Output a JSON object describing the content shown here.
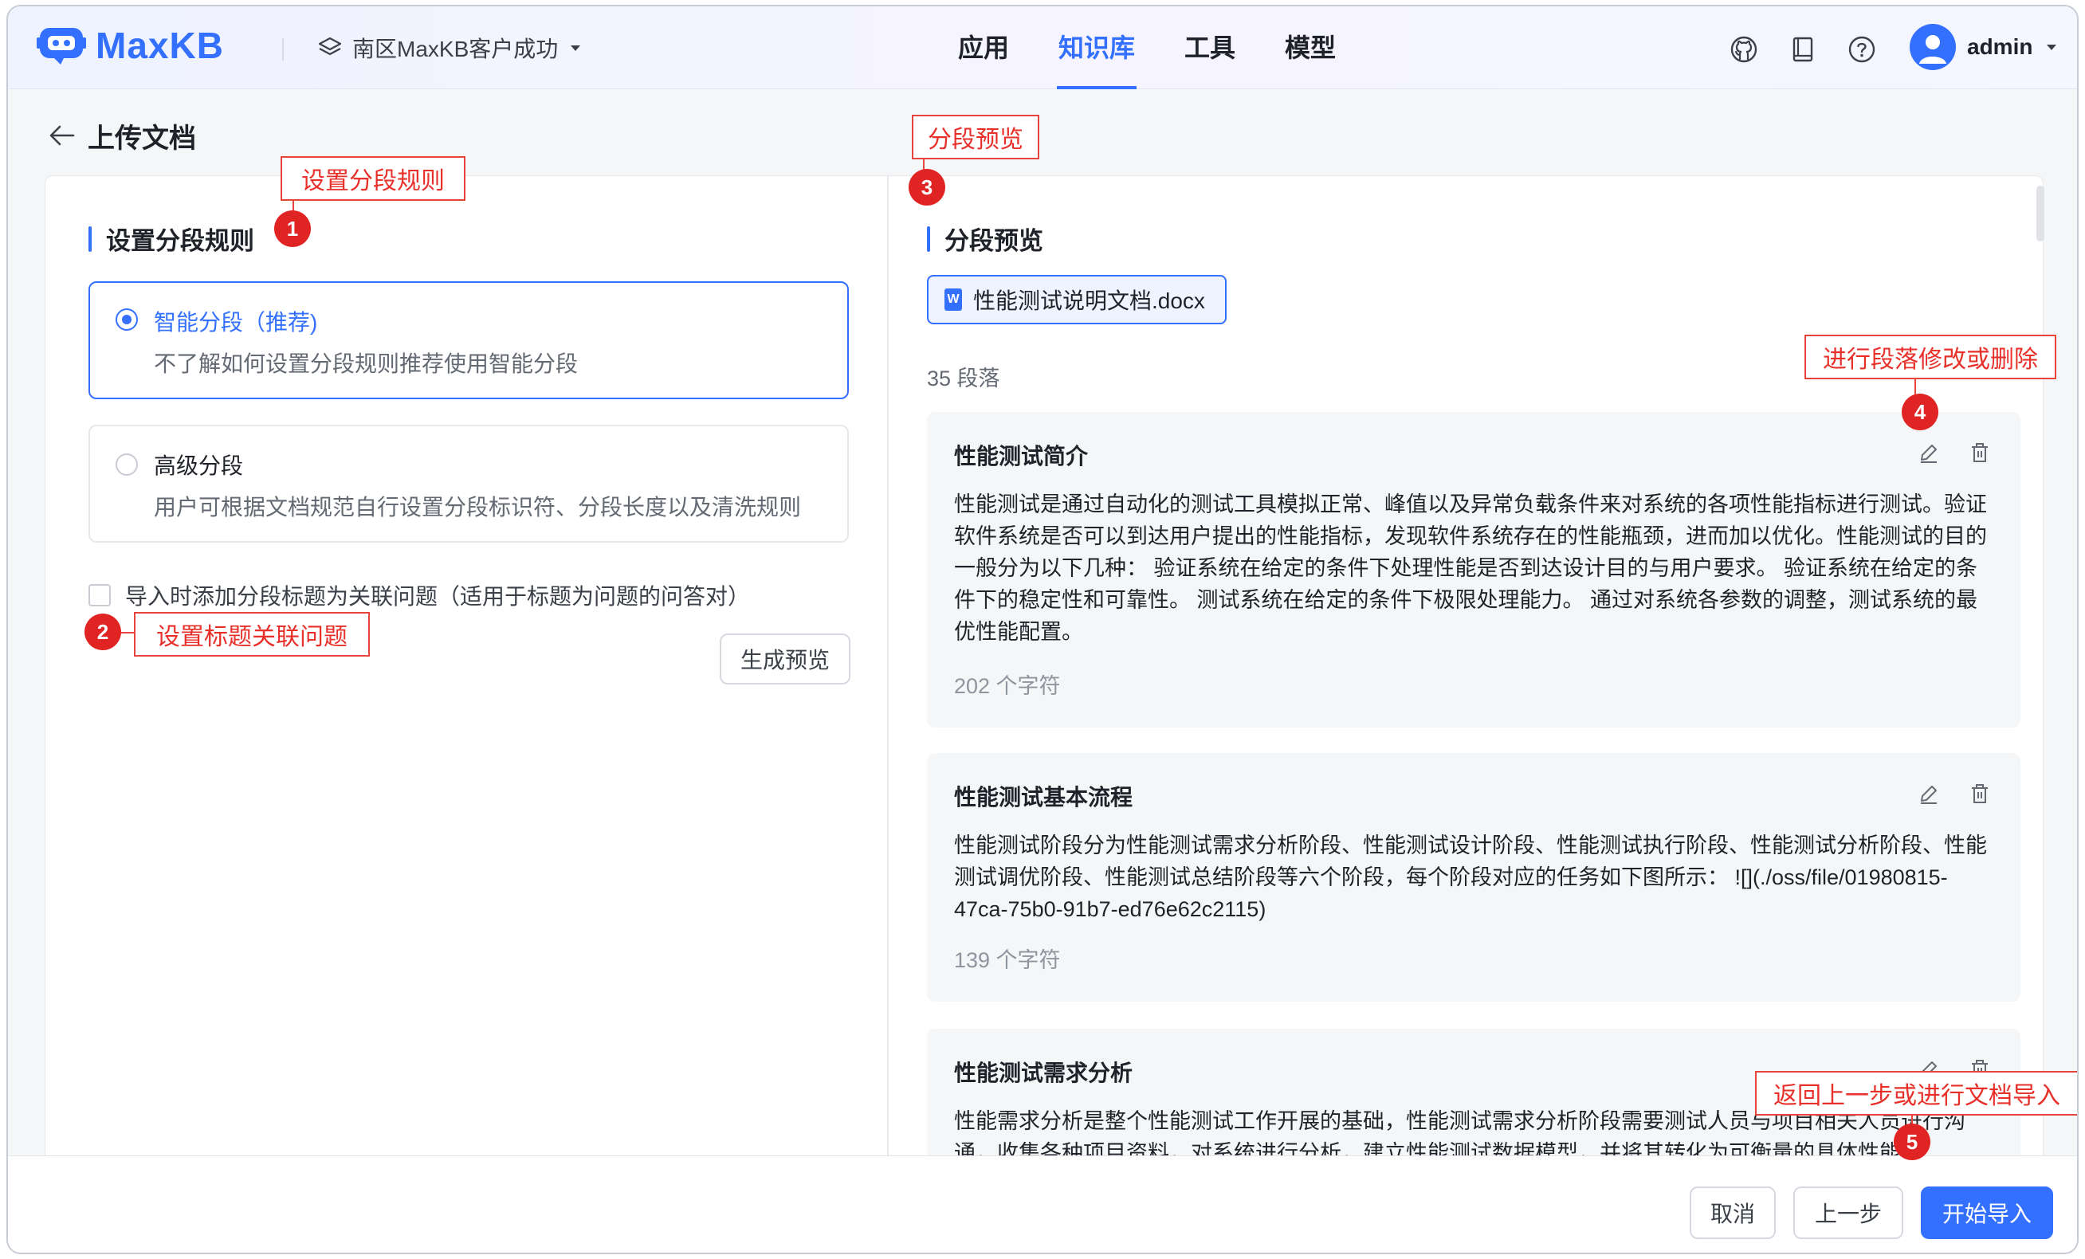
{
  "header": {
    "logo_text": "MaxKB",
    "workspace": "南区MaxKB客户成功",
    "nav": [
      "应用",
      "知识库",
      "工具",
      "模型"
    ],
    "active_nav": "知识库",
    "username": "admin",
    "accent_color": "#3370ff"
  },
  "page": {
    "title": "上传文档"
  },
  "left": {
    "section_title": "设置分段规则",
    "options": [
      {
        "title": "智能分段（推荐)",
        "desc": "不了解如何设置分段规则推荐使用智能分段",
        "selected": true
      },
      {
        "title": "高级分段",
        "desc": "用户可根据文档规范自行设置分段标识符、分段长度以及清洗规则",
        "selected": false
      }
    ],
    "checkbox_label": "导入时添加分段标题为关联问题（适用于标题为问题的问答对）",
    "preview_button": "生成预览"
  },
  "right": {
    "section_title": "分段预览",
    "file_name": "性能测试说明文档.docx",
    "paragraph_count": "35 段落",
    "paragraphs": [
      {
        "title": "性能测试简介",
        "body": "性能测试是通过自动化的测试工具模拟正常、峰值以及异常负载条件来对系统的各项性能指标进行测试。验证软件系统是否可以到达用户提出的性能指标，发现软件系统存在的性能瓶颈，进而加以优化。性能测试的目的一般分为以下几种： 验证系统在给定的条件下处理性能是否到达设计目的与用户要求。 验证系统在给定的条件下的稳定性和可靠性。 测试系统在给定的条件下极限处理能力。 通过对系统各参数的调整，测试系统的最优性能配置。",
        "chars": "202 个字符"
      },
      {
        "title": "性能测试基本流程",
        "body": "性能测试阶段分为性能测试需求分析阶段、性能测试设计阶段、性能测试执行阶段、性能测试分析阶段、性能测试调优阶段、性能测试总结阶段等六个阶段，每个阶段对应的任务如下图所示： ![](./oss/file/01980815-47ca-75b0-91b7-ed76e62c2115)",
        "chars": "139 个字符"
      },
      {
        "title": "性能测试需求分析",
        "body": "性能需求分析是整个性能测试工作开展的基础，性能测试需求分析阶段需要测试人员与项目相关人员进行沟通，收集各种项目资料，对系统进行分析，建立性能测试数据模型，并将其转化为可衡量的具体性能指",
        "chars": ""
      }
    ]
  },
  "footer": {
    "cancel": "取消",
    "prev": "上一步",
    "start": "开始导入"
  },
  "annotations": {
    "a1": "设置分段规则",
    "a2": "设置标题关联问题",
    "a3": "分段预览",
    "a4": "进行段落修改或删除",
    "a5": "返回上一步或进行文档导入",
    "n1": "1",
    "n2": "2",
    "n3": "3",
    "n4": "4",
    "n5": "5",
    "color": "#e02424"
  }
}
